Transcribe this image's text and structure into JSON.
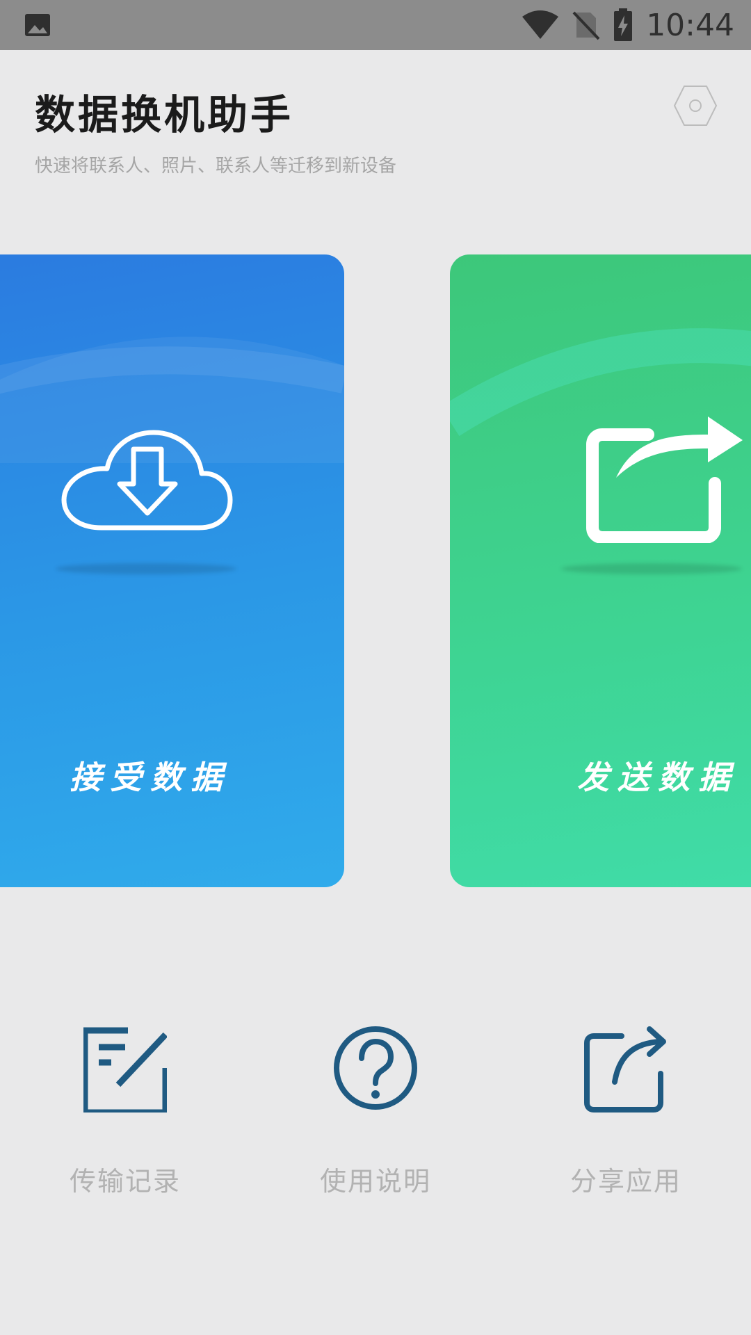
{
  "status_bar": {
    "time": "10:44",
    "icons": [
      "image-icon",
      "wifi-icon",
      "no-sim-icon",
      "battery-charging-icon"
    ]
  },
  "header": {
    "title": "数据换机助手",
    "subtitle": "快速将联系人、照片、联系人等迁移到新设备",
    "settings_icon": "hexagon-settings-icon"
  },
  "cards": [
    {
      "label": "接受数据",
      "icon": "cloud-download-icon",
      "color": "#2b8fe4"
    },
    {
      "label": "发送数据",
      "icon": "share-arrow-icon",
      "color": "#3ed391"
    }
  ],
  "actions": [
    {
      "label": "传输记录",
      "icon": "edit-record-icon"
    },
    {
      "label": "使用说明",
      "icon": "help-circle-icon"
    },
    {
      "label": "分享应用",
      "icon": "share-icon"
    }
  ],
  "colors": {
    "background": "#e9e9ea",
    "status_bar": "#8c8c8c",
    "action_icon": "#1f5a82",
    "action_label": "#b2b2b2"
  }
}
